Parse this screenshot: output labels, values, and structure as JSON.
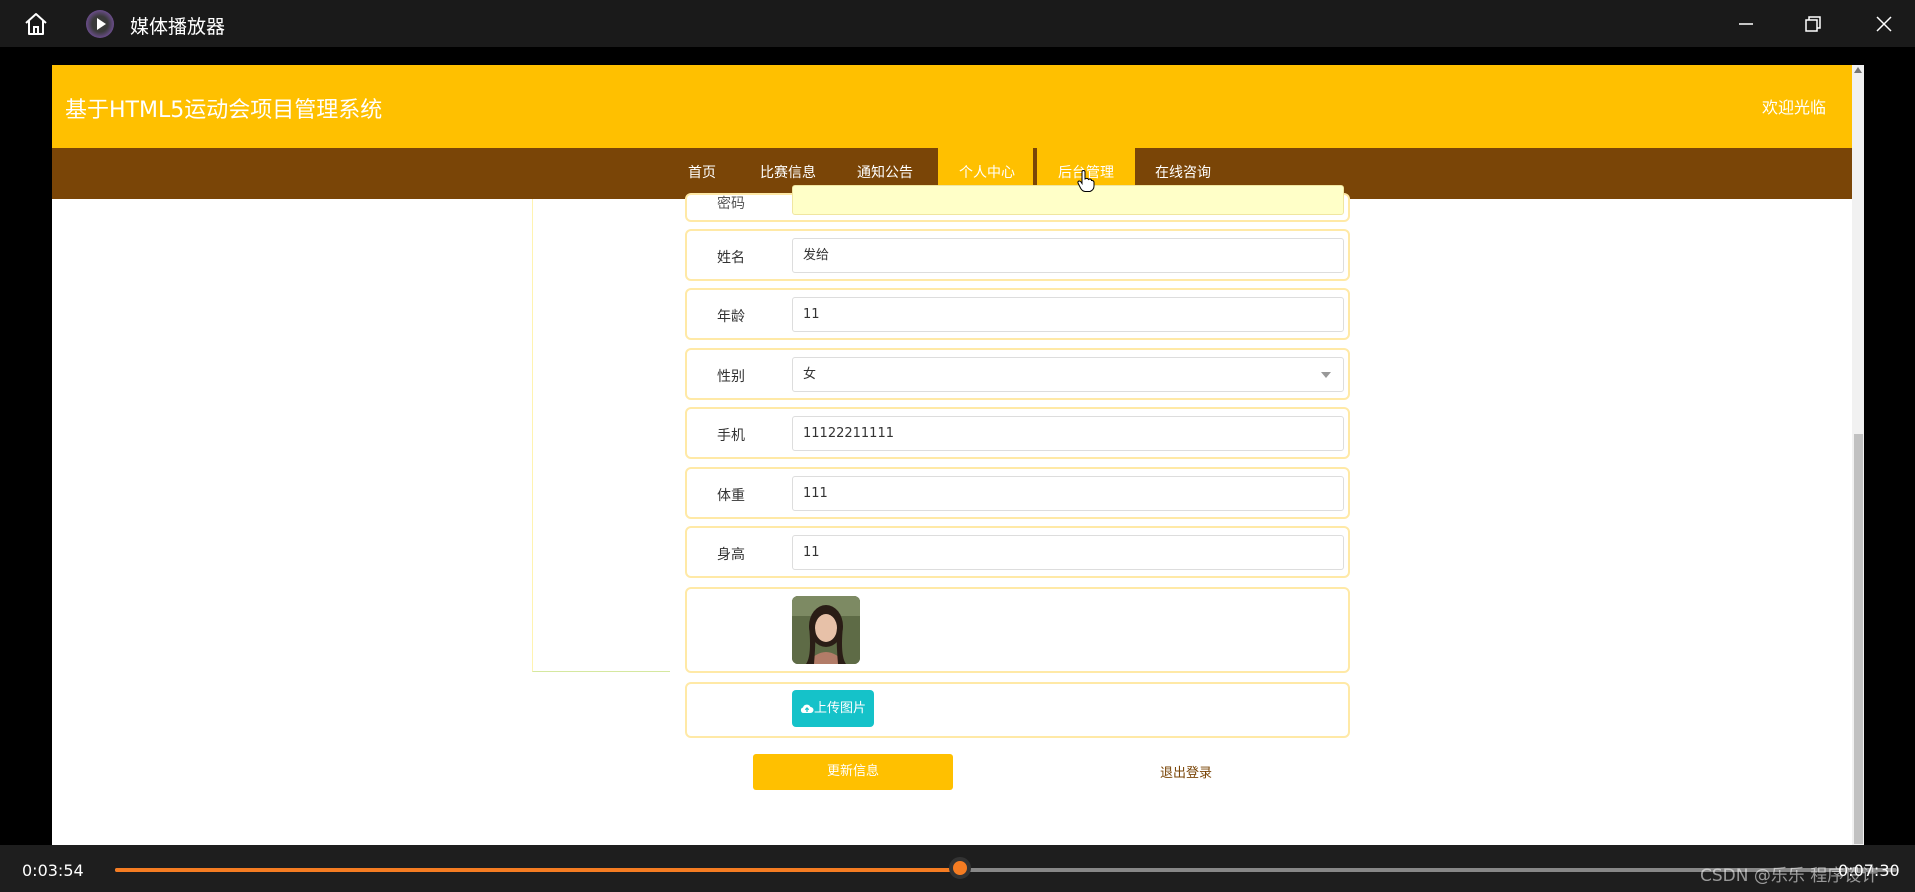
{
  "player": {
    "app_title": "媒体播放器",
    "time_current": "0:03:54",
    "time_total": "0:07:30",
    "progress": 0.474,
    "watermark": "CSDN @乐乐 程序设计"
  },
  "site": {
    "title": "基于HTML5运动会项目管理系统",
    "welcome": "欢迎光临",
    "nav": [
      {
        "label": "首页"
      },
      {
        "label": "比赛信息"
      },
      {
        "label": "通知公告"
      },
      {
        "label": "个人中心"
      },
      {
        "label": "后台管理"
      },
      {
        "label": "在线咨询"
      }
    ]
  },
  "form": {
    "top_partial_label": "密码",
    "fields": [
      {
        "label": "姓名",
        "value": "发给"
      },
      {
        "label": "年龄",
        "value": "11"
      },
      {
        "label": "性别",
        "value": "女"
      },
      {
        "label": "手机",
        "value": "11122211111"
      },
      {
        "label": "体重",
        "value": "111"
      },
      {
        "label": "身高",
        "value": "11"
      }
    ],
    "upload_label": "上传图片",
    "update_label": "更新信息",
    "logout_label": "退出登录"
  },
  "colors": {
    "header": "#ffc000",
    "navbar": "#7a4507",
    "upload": "#15c2c9",
    "progress": "#f57c22"
  }
}
